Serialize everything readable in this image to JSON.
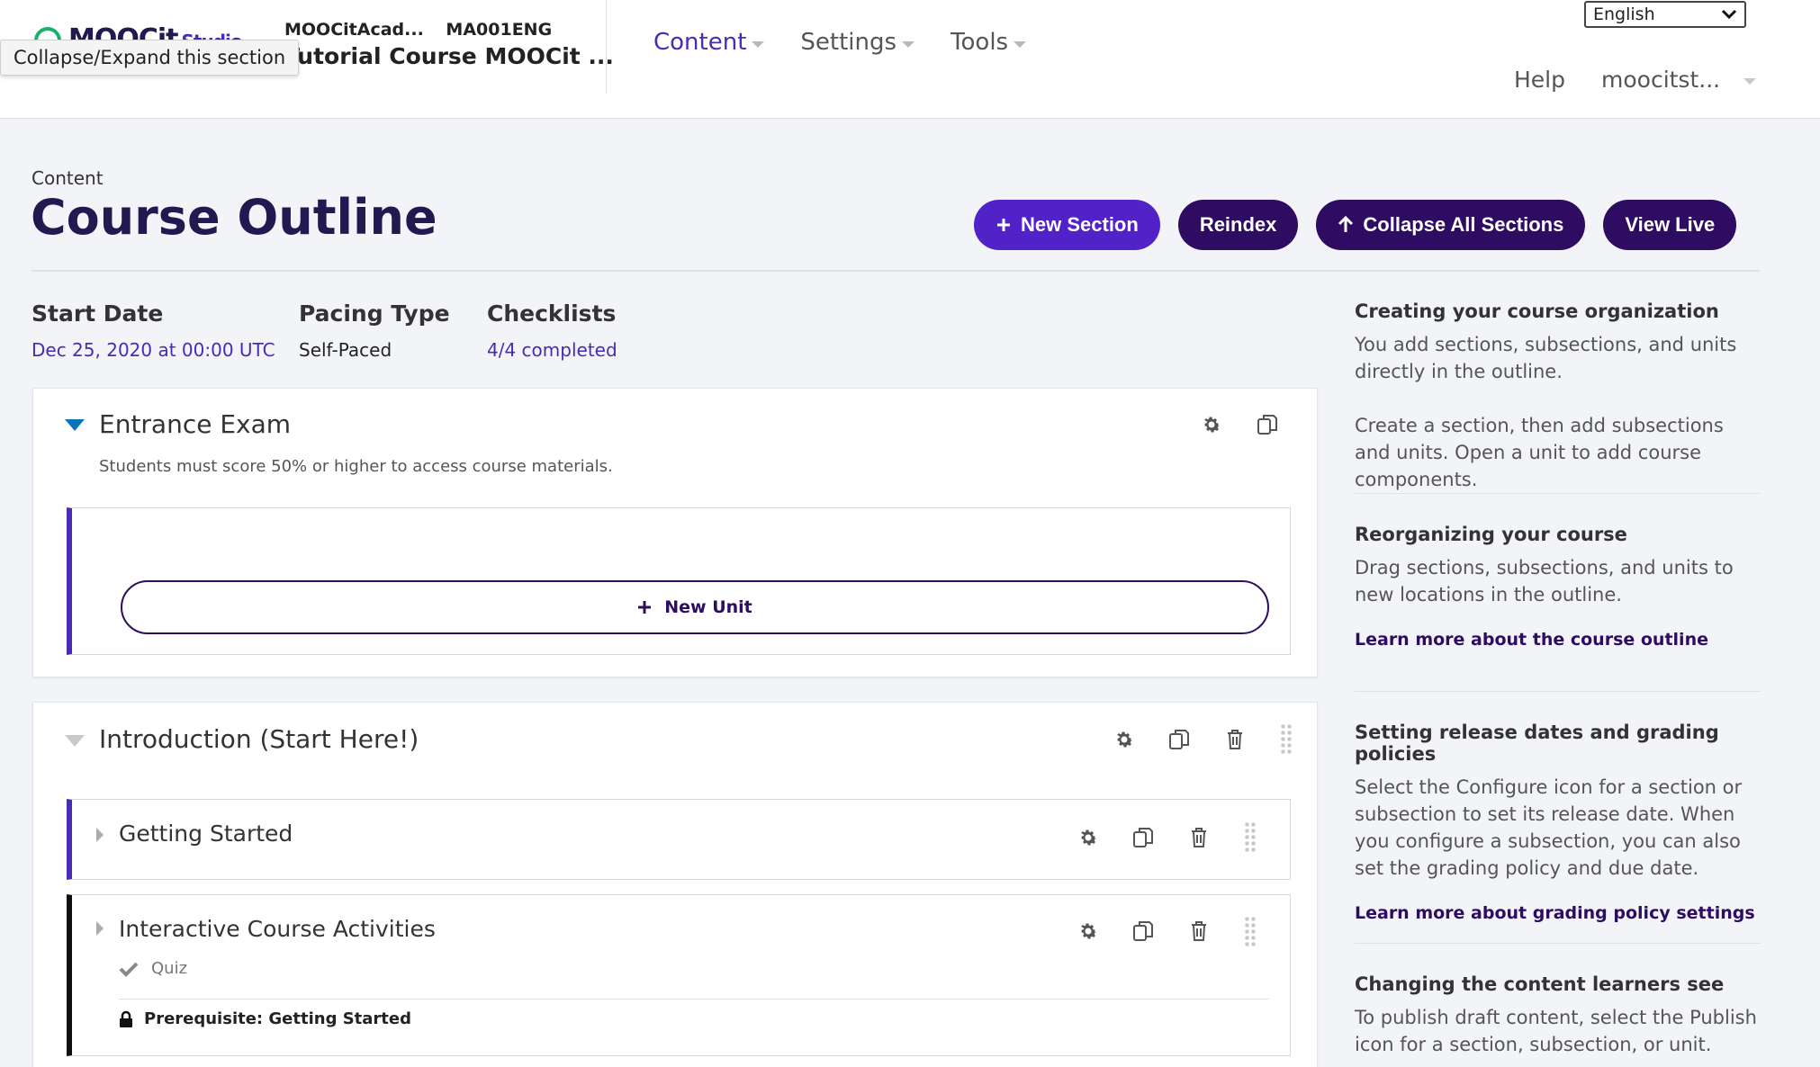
{
  "tooltip": "Collapse/Expand this section",
  "header": {
    "logo_text": "MOOCit",
    "logo_sub": "Studio",
    "org": "MOOCitAcad...",
    "course_number": "MA001ENG",
    "course_name": "Tutorial Course MOOCit ...",
    "nav": [
      {
        "label": "Content"
      },
      {
        "label": "Settings"
      },
      {
        "label": "Tools"
      }
    ],
    "language": "English",
    "help": "Help",
    "user": "moocitst..."
  },
  "page": {
    "breadcrumb": "Content",
    "title": "Course Outline",
    "actions": {
      "new_section": "New Section",
      "reindex": "Reindex",
      "collapse_all": "Collapse All Sections",
      "view_live": "View Live"
    }
  },
  "stats": {
    "start_label": "Start Date",
    "start_value": "Dec 25, 2020 at 00:00 UTC",
    "pacing_label": "Pacing Type",
    "pacing_value": "Self-Paced",
    "checklists_label": "Checklists",
    "checklists_value": "4/4 completed"
  },
  "sections": [
    {
      "title": "Entrance Exam",
      "note": "Students must score 50% or higher to access course materials.",
      "new_unit": "New Unit"
    },
    {
      "title": "Introduction (Start Here!)",
      "subsections": [
        {
          "title": "Getting Started"
        },
        {
          "title": "Interactive Course Activities",
          "tag": "Quiz",
          "prereq": "Prerequisite: Getting Started"
        }
      ]
    }
  ],
  "sidebar": [
    {
      "title": "Creating your course organization",
      "paras": [
        "You add sections, subsections, and units directly in the outline.",
        "Create a section, then add subsections and units. Open a unit to add course components."
      ]
    },
    {
      "title": "Reorganizing your course",
      "paras": [
        "Drag sections, subsections, and units to new locations in the outline."
      ],
      "link": "Learn more about the course outline"
    },
    {
      "title": "Setting release dates and grading policies",
      "paras": [
        "Select the Configure icon for a section or subsection to set its release date. When you configure a subsection, you can also set the grading policy and due date."
      ],
      "link": "Learn more about grading policy settings"
    },
    {
      "title": "Changing the content learners see",
      "paras": [
        "To publish draft content, select the Publish icon for a section, subsection, or unit."
      ]
    }
  ],
  "colors": {
    "brand_dark": "#2d0c62",
    "brand_primary": "#5022c8",
    "link": "#4b2bb3",
    "section_accent": "#4b2bb3",
    "gated_accent": "#111111",
    "expand_icon": "#0a75b9"
  }
}
